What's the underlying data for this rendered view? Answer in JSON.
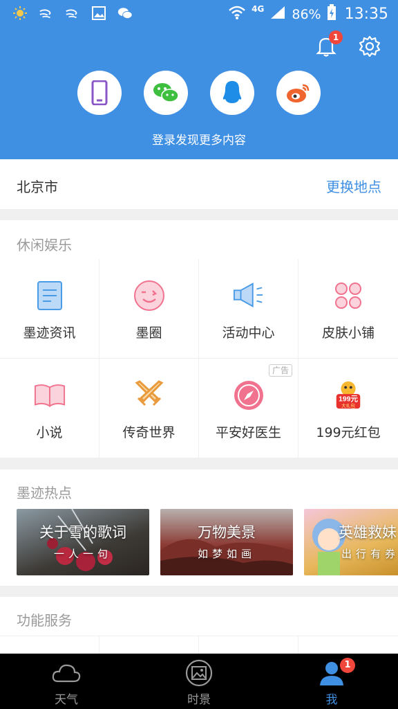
{
  "status_bar": {
    "network": "4G",
    "battery": "86%",
    "time": "13:35"
  },
  "header": {
    "notification_count": "1",
    "login_options": [
      {
        "icon": "phone-icon",
        "color": "#8a56c8"
      },
      {
        "icon": "wechat-icon",
        "color": "#3fbf3f"
      },
      {
        "icon": "qq-icon",
        "color": "#1e8de8"
      },
      {
        "icon": "weibo-icon",
        "color": "#f0642e"
      }
    ],
    "login_prompt": "登录发现更多内容"
  },
  "location": {
    "city": "北京市",
    "change_label": "更换地点"
  },
  "leisure": {
    "title": "休闲娱乐",
    "items": [
      {
        "label": "墨迹资讯",
        "icon": "news-icon"
      },
      {
        "label": "墨圈",
        "icon": "smiley-icon"
      },
      {
        "label": "活动中心",
        "icon": "megaphone-icon"
      },
      {
        "label": "皮肤小铺",
        "icon": "flower-icon"
      },
      {
        "label": "小说",
        "icon": "book-icon"
      },
      {
        "label": "传奇世界",
        "icon": "swords-icon"
      },
      {
        "label": "平安好医生",
        "icon": "compass-icon",
        "ad_tag": "广告"
      },
      {
        "label": "199元红包",
        "icon": "red-envelope-icon",
        "badge_text": "199元",
        "badge_sub": "大礼包"
      }
    ]
  },
  "hot": {
    "title": "墨迹热点",
    "cards": [
      {
        "title": "关于雪的歌词",
        "subtitle": "一人一句"
      },
      {
        "title": "万物美景",
        "subtitle": "如梦如画"
      },
      {
        "title": "英雄救妹",
        "subtitle": "出行有券"
      }
    ]
  },
  "services": {
    "title": "功能服务"
  },
  "tabbar": {
    "tabs": [
      {
        "label": "天气",
        "icon": "cloud-icon"
      },
      {
        "label": "时景",
        "icon": "photo-icon"
      },
      {
        "label": "我",
        "icon": "user-icon",
        "active": true
      }
    ],
    "me_badge": "1"
  },
  "colors": {
    "brand_blue": "#3f8fe3",
    "badge_red": "#f0463c"
  }
}
